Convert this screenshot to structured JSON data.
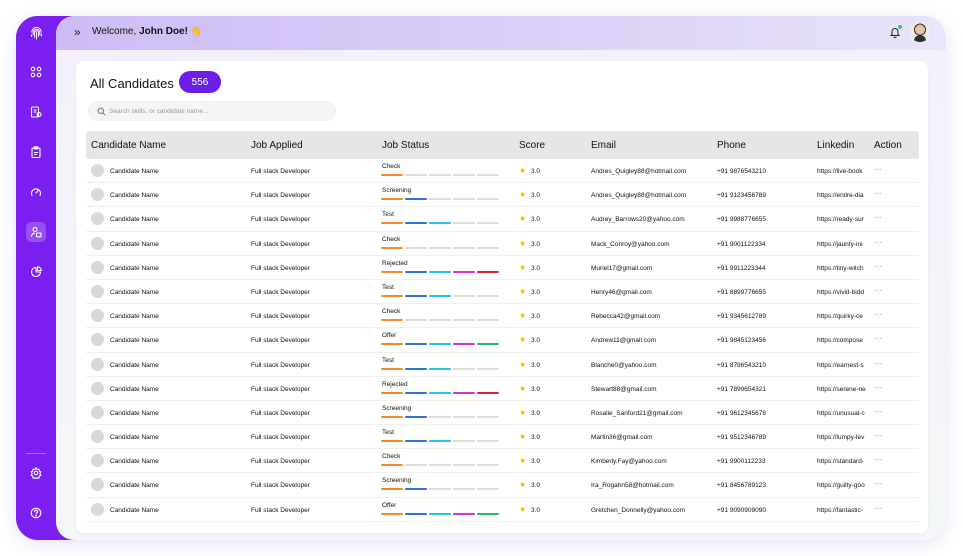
{
  "header": {
    "welcome_prefix": "Welcome,",
    "user_name": "John Doe!",
    "wave_emoji": "👋"
  },
  "sidebar": {
    "items": [
      {
        "icon": "dashboard-icon"
      },
      {
        "icon": "jobs-icon"
      },
      {
        "icon": "clipboard-icon"
      },
      {
        "icon": "speed-icon"
      },
      {
        "icon": "candidates-icon",
        "active": true
      },
      {
        "icon": "reports-icon"
      },
      {
        "icon": "settings-icon"
      },
      {
        "icon": "help-icon"
      }
    ]
  },
  "card": {
    "title": "All Candidates",
    "count": "556",
    "search_placeholder": "Search skills, or candidate name..."
  },
  "table": {
    "columns": [
      "Candidate Name",
      "Job Applied",
      "Job Status",
      "Score",
      "Email",
      "Phone",
      "Linkedin",
      "Action"
    ],
    "action_glyph": "···",
    "stage_colors": [
      "#f28c28",
      "#2f6fdb",
      "#28c0e0",
      "#d631d6",
      "#2bb673"
    ],
    "rejected_color": "#d62828",
    "rows": [
      {
        "name": "Candidate Name",
        "job": "Full stack Developer",
        "status": "Check",
        "filled": 1,
        "rejected": false,
        "score": "3.0",
        "email": "Andres_Quigley88@hotmail.com",
        "phone": "+91 9876543210",
        "linkedin": "https://live-book"
      },
      {
        "name": "Candidate Name",
        "job": "Full stack Developer",
        "status": "Screening",
        "filled": 2,
        "rejected": false,
        "score": "3.0",
        "email": "Andres_Quigley88@hotmail.com",
        "phone": "+91 9123456789",
        "linkedin": "https://entire-dia"
      },
      {
        "name": "Candidate Name",
        "job": "Full stack Developer",
        "status": "Test",
        "filled": 3,
        "rejected": false,
        "score": "3.0",
        "email": "Audrey_Barrows20@yahoo.com",
        "phone": "+91 9988776655",
        "linkedin": "https://ready-sur"
      },
      {
        "name": "Candidate Name",
        "job": "Full stack Developer",
        "status": "Check",
        "filled": 1,
        "rejected": false,
        "score": "3.0",
        "email": "Mack_Conroy@yahoo.com",
        "phone": "+91 9001122334",
        "linkedin": "https://jaunty-ini"
      },
      {
        "name": "Candidate Name",
        "job": "Full stack Developer",
        "status": "Rejected",
        "filled": 5,
        "rejected": true,
        "score": "3.0",
        "email": "Muriel17@gmail.com",
        "phone": "+91 9911223344",
        "linkedin": "https://tiny-witch"
      },
      {
        "name": "Candidate Name",
        "job": "Full stack Developer",
        "status": "Test",
        "filled": 3,
        "rejected": false,
        "score": "3.0",
        "email": "Henry46@gmail.com",
        "phone": "+91 8899776655",
        "linkedin": "https://vivid-bidd"
      },
      {
        "name": "Candidate Name",
        "job": "Full stack Developer",
        "status": "Check",
        "filled": 1,
        "rejected": false,
        "score": "3.0",
        "email": "Rebecca42@gmail.com",
        "phone": "+91 9345612789",
        "linkedin": "https://quirky-ce"
      },
      {
        "name": "Candidate Name",
        "job": "Full stack Developer",
        "status": "Offer",
        "filled": 5,
        "rejected": false,
        "score": "3.0",
        "email": "Andrew11@gmail.com",
        "phone": "+91 9845123456",
        "linkedin": "https://compose"
      },
      {
        "name": "Candidate Name",
        "job": "Full stack Developer",
        "status": "Test",
        "filled": 3,
        "rejected": false,
        "score": "3.0",
        "email": "Blanche0@yahoo.com",
        "phone": "+91 8796543210",
        "linkedin": "https://earnest-s"
      },
      {
        "name": "Candidate Name",
        "job": "Full stack Developer",
        "status": "Rejected",
        "filled": 5,
        "rejected": true,
        "score": "3.0",
        "email": "Stewart88@gmail.com",
        "phone": "+91 7890654321",
        "linkedin": "https://serene-ne"
      },
      {
        "name": "Candidate Name",
        "job": "Full stack Developer",
        "status": "Screening",
        "filled": 2,
        "rejected": false,
        "score": "3.0",
        "email": "Rosalie_Sanford21@gmail.com",
        "phone": "+91 9612345678",
        "linkedin": "https://unusual-c"
      },
      {
        "name": "Candidate Name",
        "job": "Full stack Developer",
        "status": "Test",
        "filled": 3,
        "rejected": false,
        "score": "3.0",
        "email": "Martin36@gmail.com",
        "phone": "+91 9512346789",
        "linkedin": "https://lumpy-lev"
      },
      {
        "name": "Candidate Name",
        "job": "Full stack Developer",
        "status": "Check",
        "filled": 1,
        "rejected": false,
        "score": "3.0",
        "email": "Kimberly.Fay@yahoo.com",
        "phone": "+91 9900112233",
        "linkedin": "https://standard-"
      },
      {
        "name": "Candidate Name",
        "job": "Full stack Developer",
        "status": "Screening",
        "filled": 2,
        "rejected": false,
        "score": "3.0",
        "email": "Ira_Rogahn58@hotmail.com",
        "phone": "+91 8456789123",
        "linkedin": "https://guilty-goo"
      },
      {
        "name": "Candidate Name",
        "job": "Full stack Developer",
        "status": "Offer",
        "filled": 5,
        "rejected": false,
        "score": "3.0",
        "email": "Gretchen_Donnelly@yahoo.com",
        "phone": "+91 9090909090",
        "linkedin": "https://fantastic-"
      }
    ]
  }
}
